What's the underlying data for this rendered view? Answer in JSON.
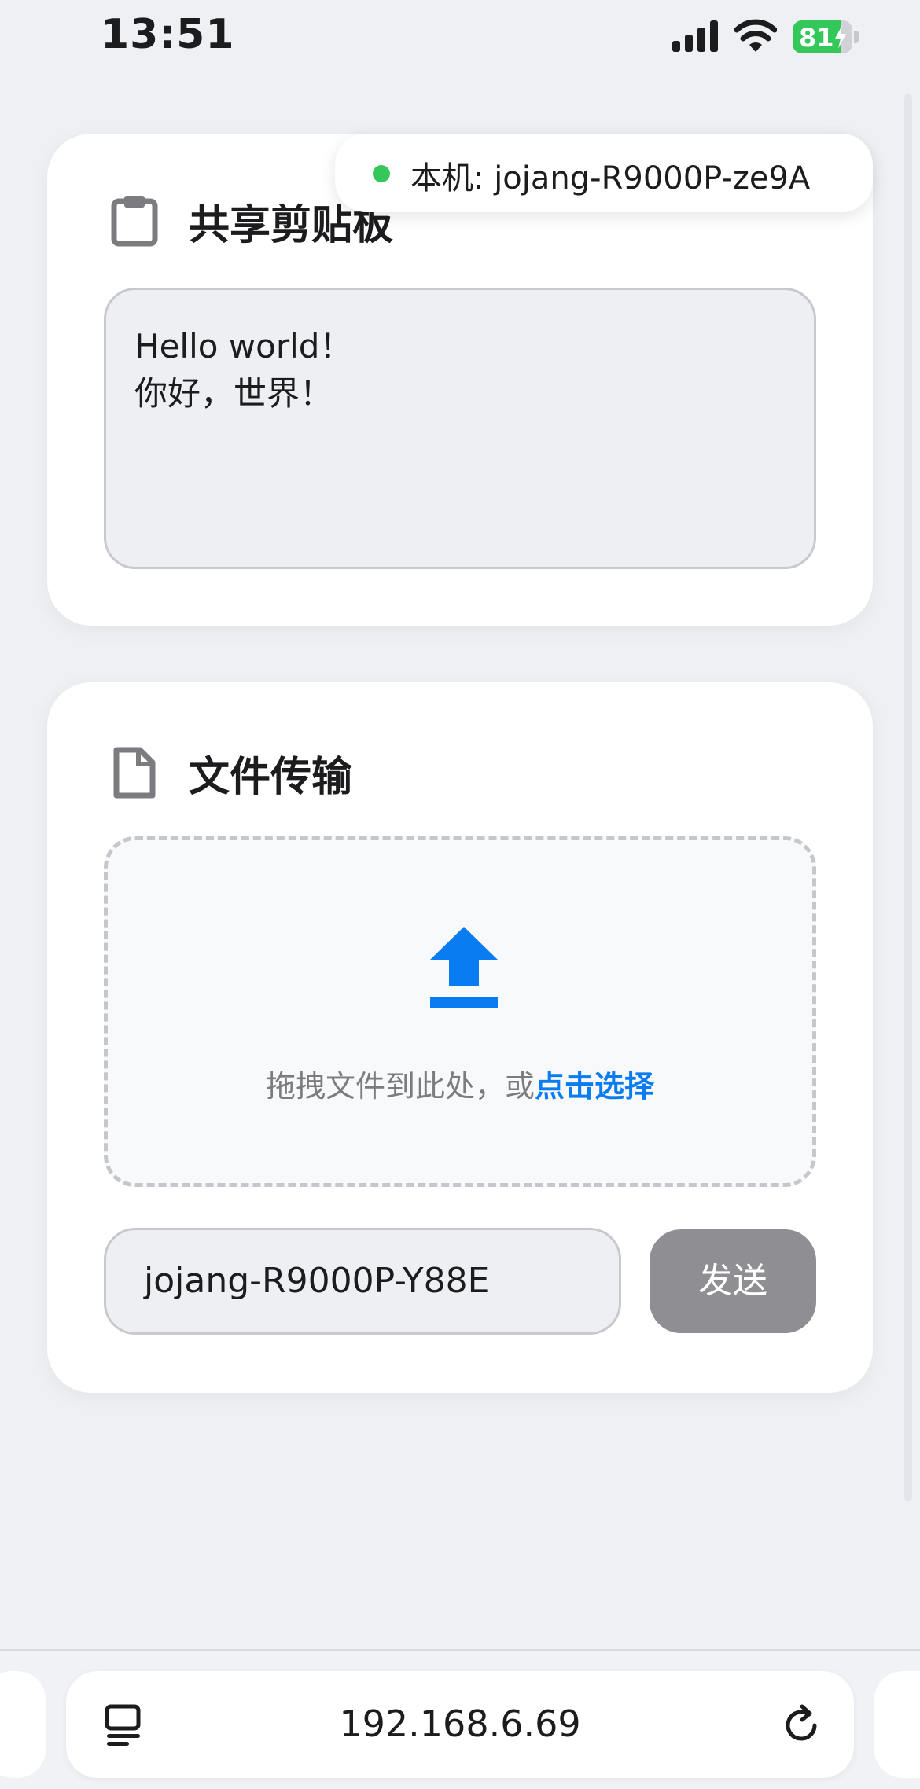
{
  "status_bar": {
    "time": "13:51",
    "battery_level": "81",
    "battery_fraction": 0.81,
    "icons": [
      "signal-icon",
      "wifi-icon",
      "battery-charging-icon"
    ]
  },
  "device_badge": {
    "label": "本机: jojang-R9000P-ze9A",
    "status_color": "#34c759"
  },
  "clipboard": {
    "title": "共享剪贴板",
    "icon": "clipboard-icon",
    "content": "Hello world！\n你好，世界！"
  },
  "file_transfer": {
    "title": "文件传输",
    "icon": "file-icon",
    "drop_icon": "upload-icon",
    "drop_text": "拖拽文件到此处，或",
    "drop_link": "点击选择",
    "target_device": "jojang-R9000P-Y88E",
    "send_label": "发送"
  },
  "browser": {
    "url": "192.168.6.69",
    "icons": [
      "reader-icon",
      "reload-icon"
    ]
  },
  "colors": {
    "accent": "#0a7cf2",
    "online": "#34c759",
    "send_button": "#8e8e93",
    "background": "#eef0f4"
  }
}
